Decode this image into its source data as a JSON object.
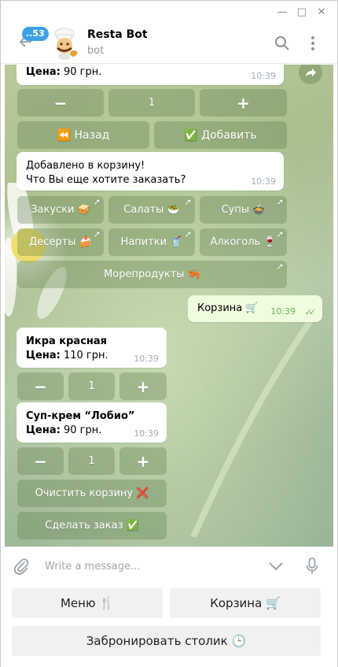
{
  "window": {
    "minimize_glyph": "—",
    "maximize_glyph": "□",
    "close_glyph": "✕"
  },
  "header": {
    "unread_count": "..53",
    "title": "Resta Bot",
    "subtitle": "bot"
  },
  "messages": {
    "top_price_label": "Цена:",
    "top_price_value": " 90 грн.",
    "top_time": "10:39",
    "qty_minus": "−",
    "qty_value": "1",
    "qty_plus": "+",
    "back_label": "⏪ Назад",
    "add_label": "✅ Добавить",
    "added_line1": "Добавлено в корзину!",
    "added_line2": "Что Вы еще хотите заказать?",
    "added_time": "10:39",
    "menu_buttons": [
      {
        "label": "Закуски 🥪"
      },
      {
        "label": "Салаты 🥗"
      },
      {
        "label": "Супы 🍲"
      },
      {
        "label": "Десерты 🍰"
      },
      {
        "label": "Напитки 🥤"
      },
      {
        "label": "Алкоголь 🍷"
      },
      {
        "label": "Морепродукты 🦐"
      }
    ],
    "out_text": "Корзина 🛒",
    "out_time": "10:39",
    "out_ticks": "✓✓",
    "item1_name": "Икра красная",
    "item1_price_label": "Цена:",
    "item1_price_value": " 110 грн.",
    "item1_time": "10:39",
    "item1_qty": "1",
    "item2_name": "Суп-крем “Лобио”",
    "item2_price_label": "Цена:",
    "item2_price_value": " 90 грн.",
    "item2_time": "10:39",
    "item2_qty": "1",
    "clear_cart": "Очистить корзину ❌",
    "make_order": "Сделать заказ ✅"
  },
  "input": {
    "placeholder": "Write a message..."
  },
  "reply_keyboard": {
    "menu": "Меню 🍴",
    "cart": "Корзина 🛒",
    "book_table": "Забронировать столик 🕒"
  }
}
